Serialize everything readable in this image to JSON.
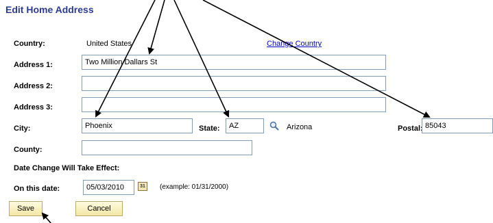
{
  "page": {
    "title": "Edit Home Address"
  },
  "form": {
    "country_label": "Country:",
    "country_value": "United States",
    "change_country_link": "Change Country",
    "address1_label": "Address 1:",
    "address1_value": "Two Million Dallars St",
    "address2_label": "Address 2:",
    "address2_value": "",
    "address3_label": "Address 3:",
    "address3_value": "",
    "city_label": "City:",
    "city_value": "Phoenix",
    "state_label": "State:",
    "state_value": "AZ",
    "state_name": "Arizona",
    "postal_label": "Postal:",
    "postal_value": "85043",
    "county_label": "County:",
    "county_value": "",
    "date_change_label": "Date Change Will Take Effect:",
    "on_this_date_label": "On this date:",
    "date_value": "05/03/2010",
    "calendar_icon_text": "31",
    "date_example": "(example: 01/31/2000)"
  },
  "buttons": {
    "save": "Save",
    "cancel": "Cancel"
  },
  "icons": {
    "lookup": "magnifier-icon",
    "calendar": "calendar-icon"
  },
  "colors": {
    "title": "#2b3a93",
    "link": "#0000cc",
    "button_bg": "#f2e6a6",
    "input_border": "#7f9db9"
  }
}
